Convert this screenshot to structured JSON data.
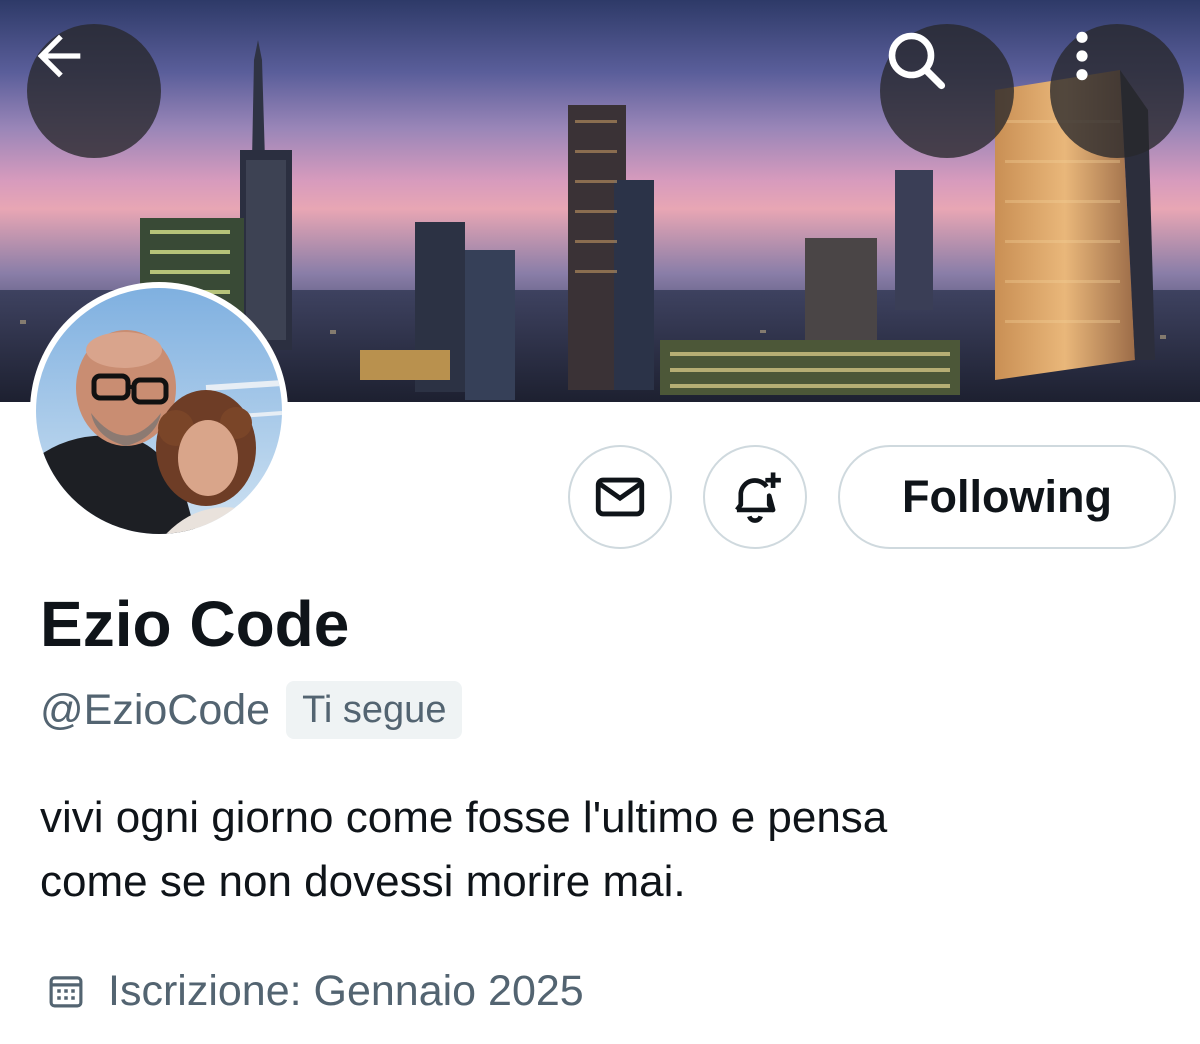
{
  "profile": {
    "display_name": "Ezio Code",
    "handle": "@EzioCode",
    "follows_you_badge": "Ti segue",
    "bio_line1": "vivi ogni giorno come fosse l'ultimo e pensa",
    "bio_line2": "come se non dovessi morire mai.",
    "joined": "Iscrizione: Gennaio 2025"
  },
  "actions": {
    "following_label": "Following"
  },
  "icons": {
    "back": "arrow-left-icon",
    "search": "search-icon",
    "more": "more-vertical-icon",
    "message": "envelope-icon",
    "notify": "bell-plus-icon",
    "joined": "calendar-icon"
  },
  "colors": {
    "text_primary": "#0f1419",
    "text_secondary": "#536471",
    "border": "#cfd9de",
    "badge_bg": "#eff3f4"
  }
}
